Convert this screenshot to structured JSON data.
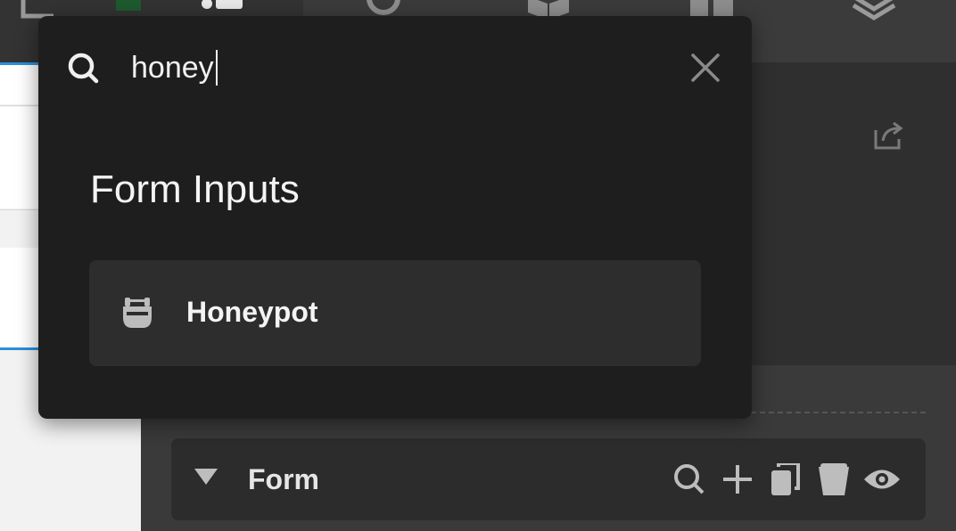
{
  "search": {
    "query": "honey",
    "placeholder": ""
  },
  "results": {
    "category": "Form Inputs",
    "items": [
      {
        "label": "Honeypot",
        "icon": "honeypot-icon"
      }
    ]
  },
  "navigator": {
    "form_label": "Form",
    "actions": [
      "search-icon",
      "plus-icon",
      "duplicate-icon",
      "trash-icon",
      "eye-icon"
    ]
  },
  "colors": {
    "popup_bg": "#1e1e1e",
    "result_bg": "#2d2d2d",
    "accent_blue": "#2b8fd8"
  }
}
